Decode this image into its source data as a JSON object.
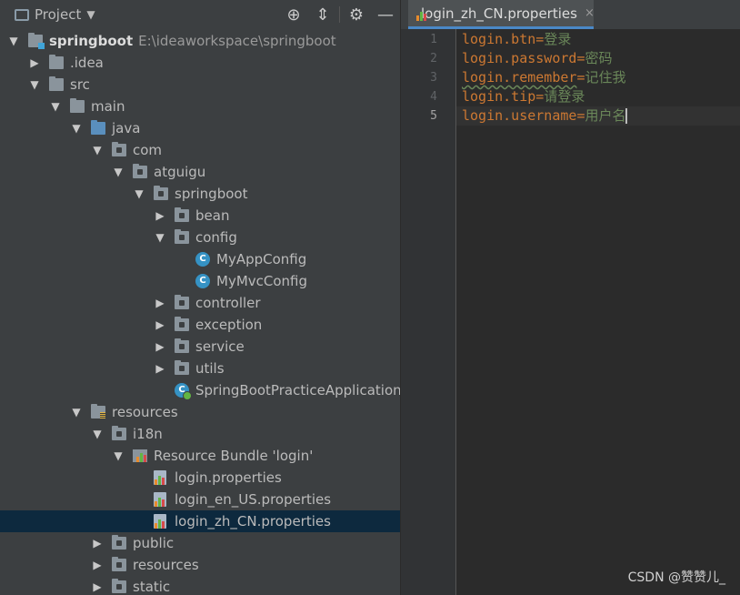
{
  "project_panel": {
    "title": "Project",
    "tools": [
      "locate-icon",
      "collapse-icon",
      "gear-icon",
      "minimize-icon"
    ],
    "tree": [
      {
        "label": "springboot",
        "path": "E:\\ideaworkspace\\springboot",
        "icon": "module-folder-icon",
        "expanded": true,
        "depth": 0
      },
      {
        "label": ".idea",
        "icon": "folder-icon",
        "expanded": false,
        "depth": 1
      },
      {
        "label": "src",
        "icon": "folder-icon",
        "expanded": true,
        "depth": 1
      },
      {
        "label": "main",
        "icon": "folder-icon",
        "expanded": true,
        "depth": 2
      },
      {
        "label": "java",
        "icon": "source-folder-icon",
        "expanded": true,
        "depth": 3
      },
      {
        "label": "com",
        "icon": "package-icon",
        "expanded": true,
        "depth": 4
      },
      {
        "label": "atguigu",
        "icon": "package-icon",
        "expanded": true,
        "depth": 5
      },
      {
        "label": "springboot",
        "icon": "package-icon",
        "expanded": true,
        "depth": 6
      },
      {
        "label": "bean",
        "icon": "package-icon",
        "expanded": false,
        "depth": 7
      },
      {
        "label": "config",
        "icon": "package-icon",
        "expanded": true,
        "depth": 7
      },
      {
        "label": "MyAppConfig",
        "icon": "class-icon",
        "depth": 8
      },
      {
        "label": "MyMvcConfig",
        "icon": "class-icon",
        "depth": 8
      },
      {
        "label": "controller",
        "icon": "package-icon",
        "expanded": false,
        "depth": 7
      },
      {
        "label": "exception",
        "icon": "package-icon",
        "expanded": false,
        "depth": 7
      },
      {
        "label": "service",
        "icon": "package-icon",
        "expanded": false,
        "depth": 7
      },
      {
        "label": "utils",
        "icon": "package-icon",
        "expanded": false,
        "depth": 7
      },
      {
        "label": "SpringBootPracticeApplication",
        "icon": "spring-app-class-icon",
        "depth": 7
      },
      {
        "label": "resources",
        "icon": "resources-folder-icon",
        "expanded": true,
        "depth": 3
      },
      {
        "label": "i18n",
        "icon": "package-icon",
        "expanded": true,
        "depth": 4
      },
      {
        "label": "Resource Bundle 'login'",
        "icon": "resource-bundle-icon",
        "expanded": true,
        "depth": 5
      },
      {
        "label": "login.properties",
        "icon": "properties-file-icon",
        "depth": 6
      },
      {
        "label": "login_en_US.properties",
        "icon": "properties-file-icon",
        "depth": 6
      },
      {
        "label": "login_zh_CN.properties",
        "icon": "properties-file-icon",
        "depth": 6,
        "selected": true
      },
      {
        "label": "public",
        "icon": "package-icon",
        "expanded": false,
        "depth": 4
      },
      {
        "label": "resources",
        "icon": "package-icon",
        "expanded": false,
        "depth": 4
      },
      {
        "label": "static",
        "icon": "package-icon",
        "expanded": false,
        "depth": 4
      }
    ]
  },
  "editor": {
    "tab": {
      "label": "login_zh_CN.properties",
      "close": "×"
    },
    "lines": [
      {
        "num": "1",
        "key": "login.btn",
        "eq": "=",
        "value": "登录"
      },
      {
        "num": "2",
        "key": "login.password",
        "eq": "=",
        "value": "密码"
      },
      {
        "num": "3",
        "key": "login.remember",
        "eq": "=",
        "value": "记住我"
      },
      {
        "num": "4",
        "key": "login.tip",
        "eq": "=",
        "value": "请登录"
      },
      {
        "num": "5",
        "key": "login.username",
        "eq": "=",
        "value": "用户名"
      }
    ]
  },
  "watermark": "CSDN @赞赞儿_",
  "colors": {
    "selection": "#0d293e",
    "key": "#cc7832",
    "value": "#6a8759",
    "tab_underline": "#4a88c7"
  }
}
